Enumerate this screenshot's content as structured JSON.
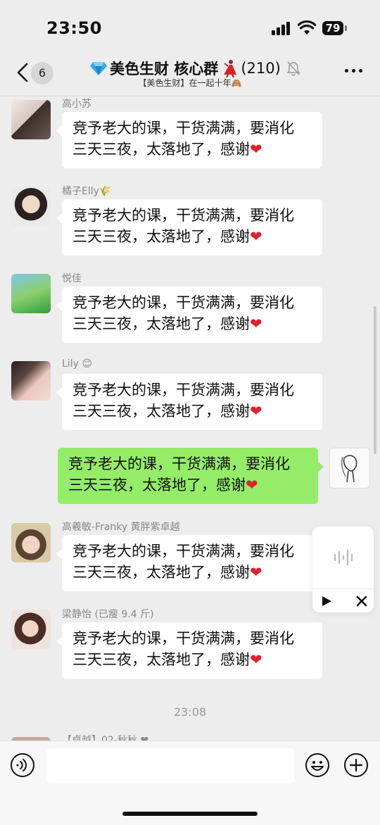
{
  "status": {
    "time": "23:50",
    "battery": "79"
  },
  "nav": {
    "unread_count": "6",
    "title": "美色生财 核心群",
    "member_count": "(210)",
    "subtitle": "【美色生财】在一起十年🙈"
  },
  "messages": [
    {
      "sender": "高小苏",
      "line1": "竞予老大的课，干货满满，要消化",
      "line2": "三天三夜，太落地了，感谢",
      "heart": "❤"
    },
    {
      "sender": "橘子Elly🌾",
      "line1": "竞予老大的课，干货满满，要消化",
      "line2": "三天三夜，太落地了，感谢",
      "heart": "❤"
    },
    {
      "sender": "悦佳",
      "line1": "竞予老大的课，干货满满，要消化",
      "line2": "三天三夜，太落地了，感谢",
      "heart": "❤"
    },
    {
      "sender": "Lily 😊",
      "line1": "竞予老大的课，干货满满，要消化",
      "line2": "三天三夜，太落地了，感谢",
      "heart": "❤"
    },
    {
      "sender": "",
      "line1": "竞予老大的课，干货满满，要消化",
      "line2": "三天三夜，太落地了，感谢",
      "heart": "❤",
      "mine": true
    },
    {
      "sender": "高羲敏-Franky 黄胖紫卓越",
      "line1": "竞予老大的课，干货满满，要消化",
      "line2": "三天三夜，太落地了，感谢",
      "heart": "❤"
    },
    {
      "sender": "梁静怡 (已瘦 9.4 斤)",
      "line1": "竞予老大的课，干货满满，要消化",
      "line2": "三天三夜，太落地了，感谢",
      "heart": "❤"
    }
  ],
  "timestamp": "23:08",
  "peek_sender": "【卓越】02-秋秋 ❤",
  "input": {
    "placeholder": ""
  },
  "colors": {
    "my_bubble": "#95ec69",
    "other_bubble": "#ffffff",
    "background": "#ededed",
    "heart": "#e0202d"
  }
}
